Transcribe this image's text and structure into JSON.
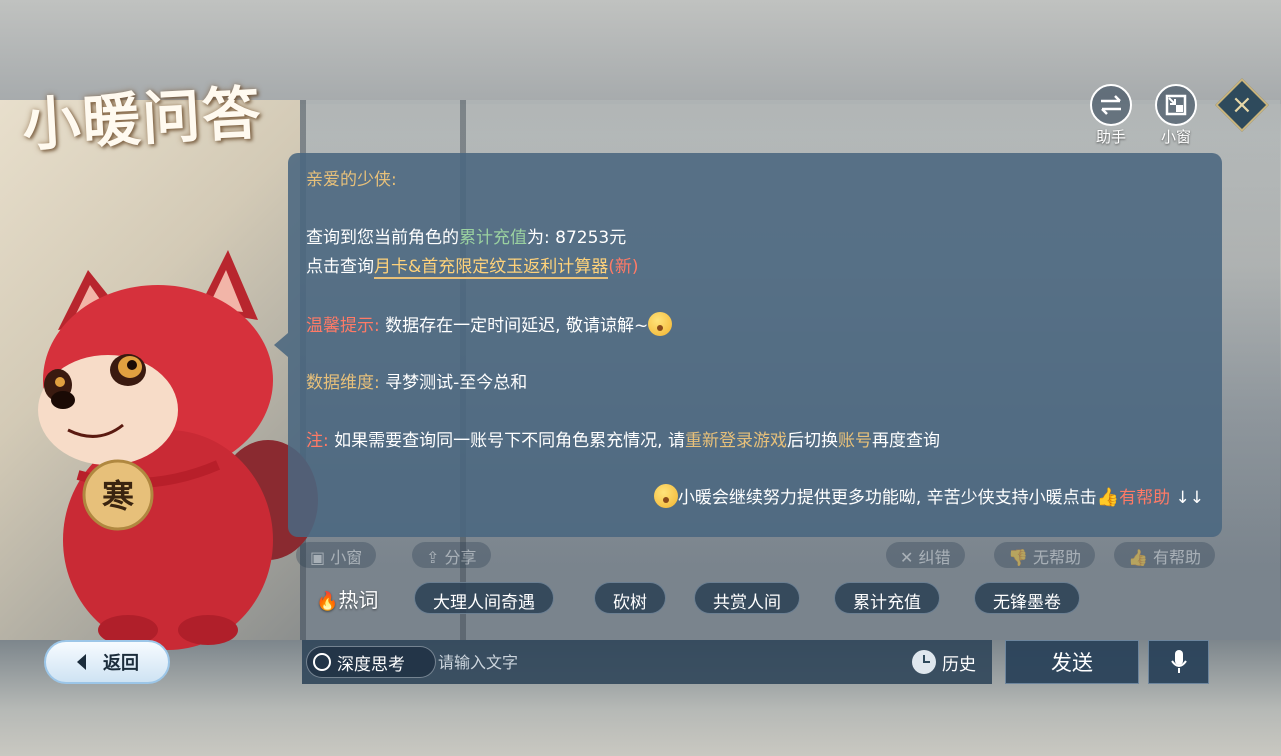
{
  "app": {
    "title": "小暖问答"
  },
  "top_buttons": [
    {
      "label": "助手",
      "icon": "swap-arrows-icon"
    },
    {
      "label": "小窗",
      "icon": "mini-window-icon"
    }
  ],
  "close_icon": "close-diamond-icon",
  "message": {
    "greeting": "亲爱的少侠:",
    "line1_prefix": "查询到您当前角色的",
    "line1_highlight": "累计充值",
    "line1_suffix": "为: 87253元",
    "line2_prefix": "点击查询",
    "line2_link": "月卡&首充限定纹玉返利计算器",
    "line2_tag": "(新)",
    "tip_label": "温馨提示:",
    "tip_text": "数据存在一定时间延迟, 敬请谅解~",
    "dim_label": "数据维度:",
    "dim_text": "寻梦测试-至今总和",
    "note_label": "注:",
    "note_text_1": "如果需要查询同一账号下不同角色累充情况, 请",
    "note_link_1": "重新登录游戏",
    "note_text_2": "后切换",
    "note_link_2": "账号",
    "note_text_3": "再度查询",
    "footer_text": "小暖会继续努力提供更多功能呦, 辛苦少侠支持小暖点击",
    "footer_link": "有帮助",
    "footer_arrows": "↓↓"
  },
  "feedback_buttons": [
    "小窗",
    "分享",
    "纠错",
    "无帮助",
    "有帮助"
  ],
  "hot_words": {
    "label": "热词",
    "items": [
      "大理人间奇遇",
      "砍树",
      "共赏人间",
      "累计充值",
      "无锋墨卷"
    ]
  },
  "bottom_bar": {
    "back_label": "返回",
    "deep_think_label": "深度思考",
    "input_placeholder": "请输入文字",
    "history_label": "历史",
    "send_label": "发送"
  },
  "mascot": {
    "badge_text": "寒"
  },
  "colors": {
    "bubble_bg": "#4a6680",
    "gold": "#e7c07a",
    "green": "#9ad1a0",
    "red": "#ff7a66"
  }
}
